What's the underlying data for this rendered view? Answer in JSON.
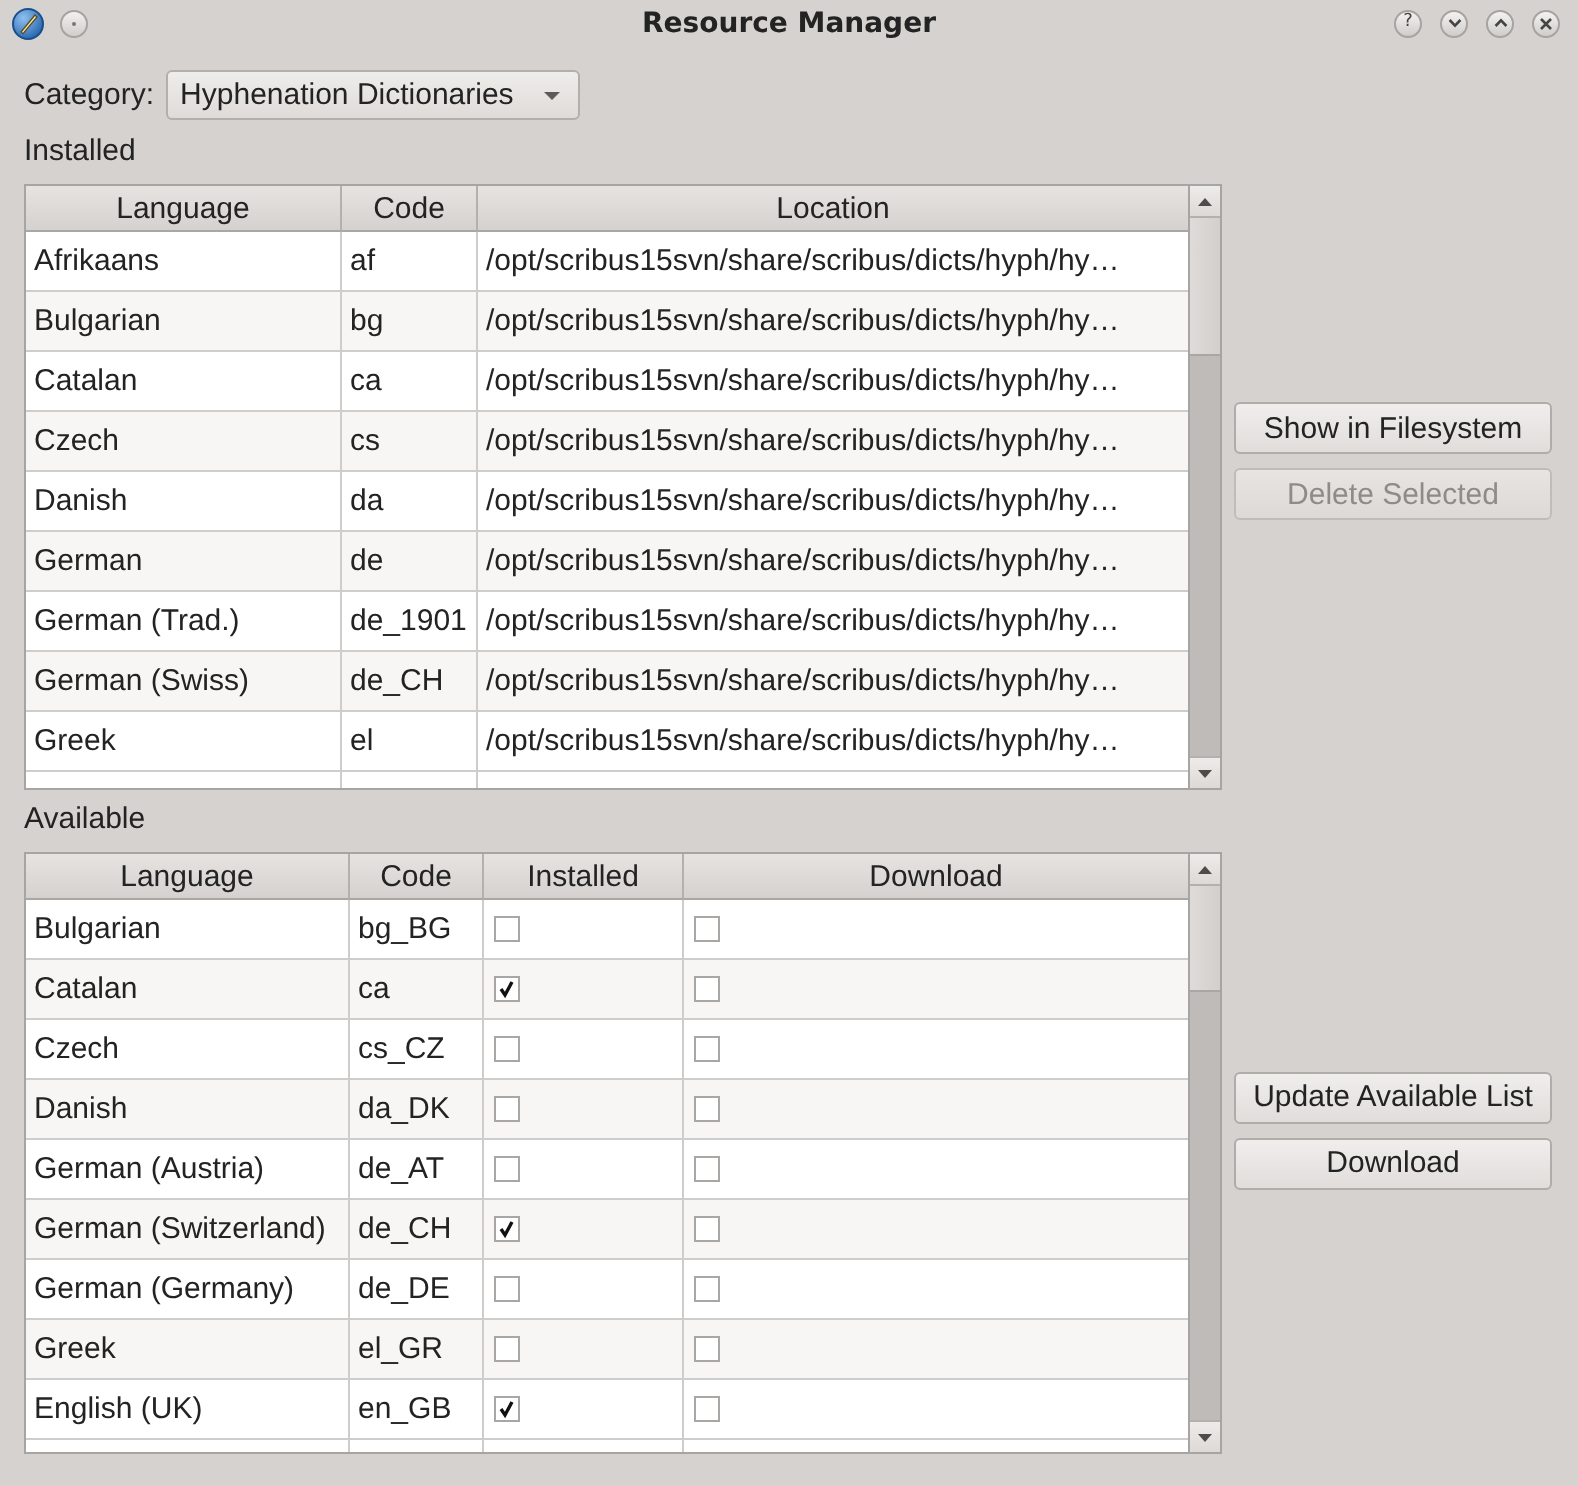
{
  "window": {
    "title": "Resource Manager",
    "buttons": [
      {
        "kind": "help",
        "glyph": "?"
      },
      {
        "kind": "minimize"
      },
      {
        "kind": "maximize"
      },
      {
        "kind": "close"
      }
    ]
  },
  "category": {
    "label": "Category:",
    "value": "Hyphenation Dictionaries"
  },
  "installed": {
    "label": "Installed",
    "columns": [
      "Language",
      "Code",
      "Location"
    ],
    "rows": [
      {
        "language": "Afrikaans",
        "code": "af",
        "location": "/opt/scribus15svn/share/scribus/dicts/hyph/hy…"
      },
      {
        "language": "Bulgarian",
        "code": "bg",
        "location": "/opt/scribus15svn/share/scribus/dicts/hyph/hy…"
      },
      {
        "language": "Catalan",
        "code": "ca",
        "location": "/opt/scribus15svn/share/scribus/dicts/hyph/hy…"
      },
      {
        "language": "Czech",
        "code": "cs",
        "location": "/opt/scribus15svn/share/scribus/dicts/hyph/hy…"
      },
      {
        "language": "Danish",
        "code": "da",
        "location": "/opt/scribus15svn/share/scribus/dicts/hyph/hy…"
      },
      {
        "language": "German",
        "code": "de",
        "location": "/opt/scribus15svn/share/scribus/dicts/hyph/hy…"
      },
      {
        "language": "German (Trad.)",
        "code": "de_1901",
        "location": "/opt/scribus15svn/share/scribus/dicts/hyph/hy…"
      },
      {
        "language": "German (Swiss)",
        "code": "de_CH",
        "location": "/opt/scribus15svn/share/scribus/dicts/hyph/hy…"
      },
      {
        "language": "Greek",
        "code": "el",
        "location": "/opt/scribus15svn/share/scribus/dicts/hyph/hy…"
      }
    ]
  },
  "installed_actions": [
    {
      "label": "Show in Filesystem",
      "disabled": false
    },
    {
      "label": "Delete Selected",
      "disabled": true
    }
  ],
  "available": {
    "label": "Available",
    "columns": [
      "Language",
      "Code",
      "Installed",
      "Download"
    ],
    "rows": [
      {
        "language": "Bulgarian",
        "code": "bg_BG",
        "installed": false,
        "download": false
      },
      {
        "language": "Catalan",
        "code": "ca",
        "installed": true,
        "download": false
      },
      {
        "language": "Czech",
        "code": "cs_CZ",
        "installed": false,
        "download": false
      },
      {
        "language": "Danish",
        "code": "da_DK",
        "installed": false,
        "download": false
      },
      {
        "language": "German (Austria)",
        "code": "de_AT",
        "installed": false,
        "download": false
      },
      {
        "language": "German (Switzerland)",
        "code": "de_CH",
        "installed": true,
        "download": false
      },
      {
        "language": "German (Germany)",
        "code": "de_DE",
        "installed": false,
        "download": false
      },
      {
        "language": "Greek",
        "code": "el_GR",
        "installed": false,
        "download": false
      },
      {
        "language": "English (UK)",
        "code": "en_GB",
        "installed": true,
        "download": false
      }
    ]
  },
  "available_actions": [
    {
      "label": "Update Available List",
      "disabled": false
    },
    {
      "label": "Download",
      "disabled": false
    }
  ]
}
